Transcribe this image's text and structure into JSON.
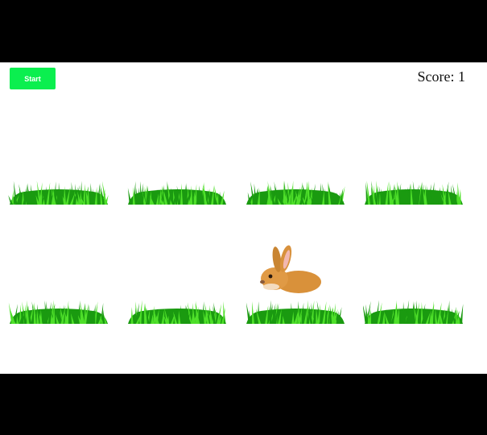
{
  "game": {
    "start_label": "Start",
    "score_label": "Score:",
    "score_value": "1"
  },
  "holes": [
    {
      "has_bunny": false
    },
    {
      "has_bunny": false
    },
    {
      "has_bunny": false
    },
    {
      "has_bunny": false
    },
    {
      "has_bunny": false
    },
    {
      "has_bunny": false
    },
    {
      "has_bunny": true
    },
    {
      "has_bunny": false
    }
  ],
  "colors": {
    "start_button": "#0bef4f",
    "grass_dark": "#1a9a10",
    "grass_light": "#4fe02a",
    "bunny_fur": "#d9913a"
  }
}
